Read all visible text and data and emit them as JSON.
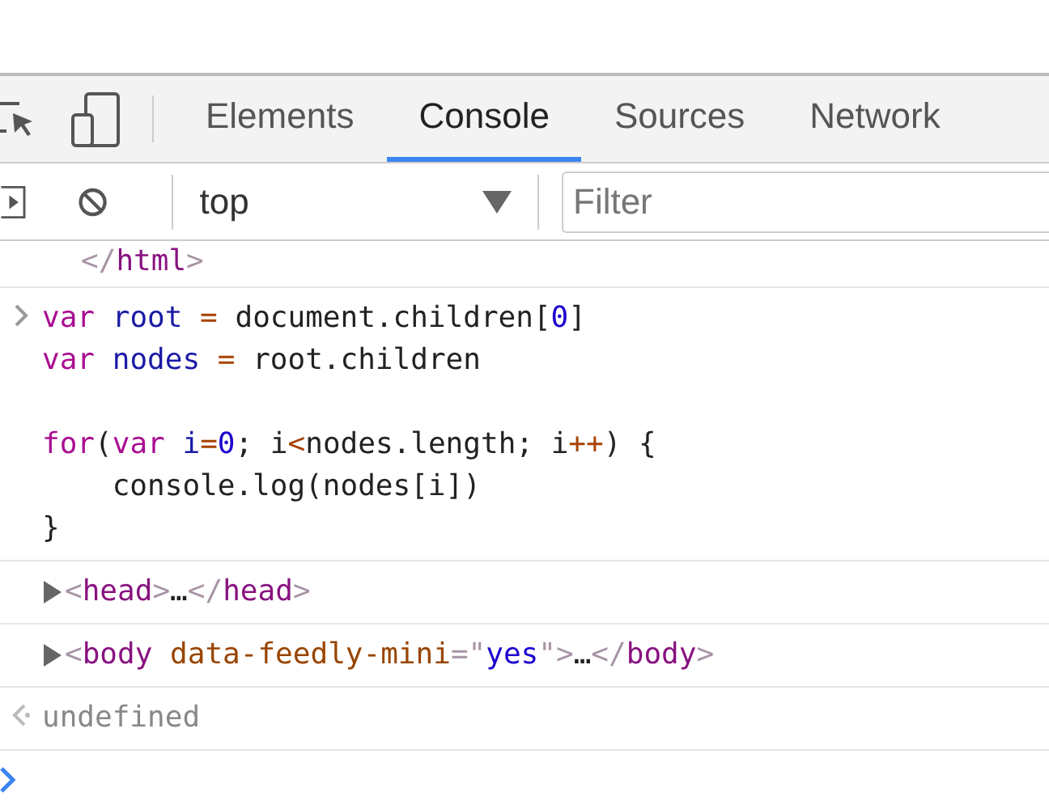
{
  "tabs": [
    {
      "label": "Elements",
      "selected": false
    },
    {
      "label": "Console",
      "selected": true
    },
    {
      "label": "Sources",
      "selected": false
    },
    {
      "label": "Network",
      "selected": false
    }
  ],
  "toolbar": {
    "context": "top",
    "filter_placeholder": "Filter"
  },
  "console": [
    {
      "kind": "log",
      "blocks": [
        [
          [
            {
              "kind": "bracket",
              "text": "</"
            },
            {
              "kind": "tag",
              "text": "html"
            },
            {
              "kind": "bracket",
              "text": ">"
            }
          ]
        ]
      ]
    },
    {
      "kind": "input",
      "blocks": [
        [
          [
            {
              "kind": "keyword",
              "text": "var"
            },
            {
              "kind": "variable",
              "text": " root"
            },
            {
              "kind": "operator",
              "text": " ="
            },
            {
              "kind": "plain",
              "text": " document.children["
            },
            {
              "kind": "number",
              "text": "0"
            },
            {
              "kind": "plain",
              "text": "]"
            }
          ],
          [
            {
              "kind": "keyword",
              "text": "var"
            },
            {
              "kind": "variable",
              "text": " nodes"
            },
            {
              "kind": "operator",
              "text": " ="
            },
            {
              "kind": "plain",
              "text": " root.children"
            }
          ]
        ],
        [
          [
            {
              "kind": "keyword",
              "text": "for"
            },
            {
              "kind": "plain",
              "text": "("
            },
            {
              "kind": "keyword",
              "text": "var"
            },
            {
              "kind": "variable",
              "text": " i"
            },
            {
              "kind": "operator",
              "text": "="
            },
            {
              "kind": "number",
              "text": "0"
            },
            {
              "kind": "plain",
              "text": "; i"
            },
            {
              "kind": "operator",
              "text": "<"
            },
            {
              "kind": "plain",
              "text": "nodes.length; i"
            },
            {
              "kind": "operator",
              "text": "++"
            },
            {
              "kind": "plain",
              "text": ") {"
            }
          ],
          [
            {
              "kind": "plain",
              "text": "    console.log(nodes[i])"
            }
          ],
          [
            {
              "kind": "plain",
              "text": "}"
            }
          ]
        ]
      ]
    },
    {
      "kind": "element",
      "expanded": false,
      "blocks": [
        [
          [
            {
              "kind": "bracket",
              "text": "<"
            },
            {
              "kind": "tag",
              "text": "head"
            },
            {
              "kind": "bracket",
              "text": ">"
            },
            {
              "kind": "plain",
              "text": "…"
            },
            {
              "kind": "bracket",
              "text": "</"
            },
            {
              "kind": "tag",
              "text": "head"
            },
            {
              "kind": "bracket",
              "text": ">"
            }
          ]
        ]
      ]
    },
    {
      "kind": "element",
      "expanded": false,
      "blocks": [
        [
          [
            {
              "kind": "bracket",
              "text": "<"
            },
            {
              "kind": "tag",
              "text": "body"
            },
            {
              "kind": "attr",
              "text": " data-feedly-mini"
            },
            {
              "kind": "bracket",
              "text": "=\""
            },
            {
              "kind": "number",
              "text": "yes"
            },
            {
              "kind": "bracket",
              "text": "\">"
            },
            {
              "kind": "plain",
              "text": "…"
            },
            {
              "kind": "bracket",
              "text": "</"
            },
            {
              "kind": "tag",
              "text": "body"
            },
            {
              "kind": "bracket",
              "text": ">"
            }
          ]
        ]
      ]
    },
    {
      "kind": "result",
      "blocks": [
        [
          [
            {
              "kind": "muted",
              "text": "undefined"
            }
          ]
        ]
      ]
    }
  ]
}
